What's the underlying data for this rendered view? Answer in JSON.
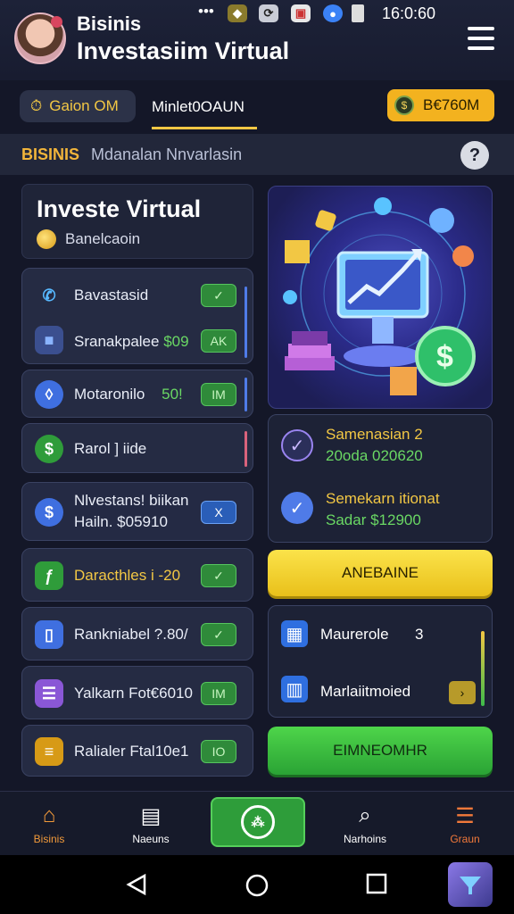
{
  "status": {
    "dots": "•••",
    "time": "16:0:60"
  },
  "header": {
    "brand": "Bisinis",
    "title": "Investasiim Virtual"
  },
  "tabs": {
    "left_pill": "Gaion OM",
    "active": "Minlet0OAUN",
    "balance": "B€760M"
  },
  "section": {
    "tag": "BISINIS",
    "subtitle": "Mdanalan Nnvarlasin"
  },
  "hero": {
    "title": "Investe Virtual",
    "subtitle": "Banelcaoin"
  },
  "rows": [
    {
      "label": "Bavastasid",
      "value": "",
      "badge": "✓"
    },
    {
      "label": "Sranakpalee",
      "value": "$09",
      "badge": "AK"
    },
    {
      "label": "Motaronilo",
      "value": "50!",
      "badge": "IM"
    },
    {
      "label": "Rarol ] iide",
      "value": "",
      "badge": ""
    },
    {
      "line1": "Nlvestans! biikan",
      "line2": "Hailn. $05910",
      "badge": "X"
    },
    {
      "label": "Daracthles",
      "value": "i -20",
      "badge": "✓"
    },
    {
      "label": "Rankniabel ?.80/",
      "value": "",
      "badge": "✓"
    },
    {
      "label": "Yalkarn Fot€6010",
      "value": "",
      "badge": "IM"
    },
    {
      "label": "Ralialer Ftal10e1",
      "value": "",
      "badge": "IO"
    }
  ],
  "stats": [
    {
      "title": "Samenasian 2",
      "detail": "20oda 020620"
    },
    {
      "title": "Semekarn itionat",
      "detail": "Sadar $12900"
    }
  ],
  "buttons": {
    "primary": "ANEBAINE",
    "secondary": "EIMNEOMHR"
  },
  "market": {
    "item1": "Maurerole",
    "item1_value": "3",
    "item2": "Marlaiitmoied"
  },
  "nav": {
    "home": "Bisinis",
    "news": "Naeuns",
    "search": "Narhoins",
    "growth": "Graun"
  },
  "colors": {
    "accent_gold": "#f2c744",
    "accent_green": "#55cf5b",
    "background": "#141728"
  }
}
